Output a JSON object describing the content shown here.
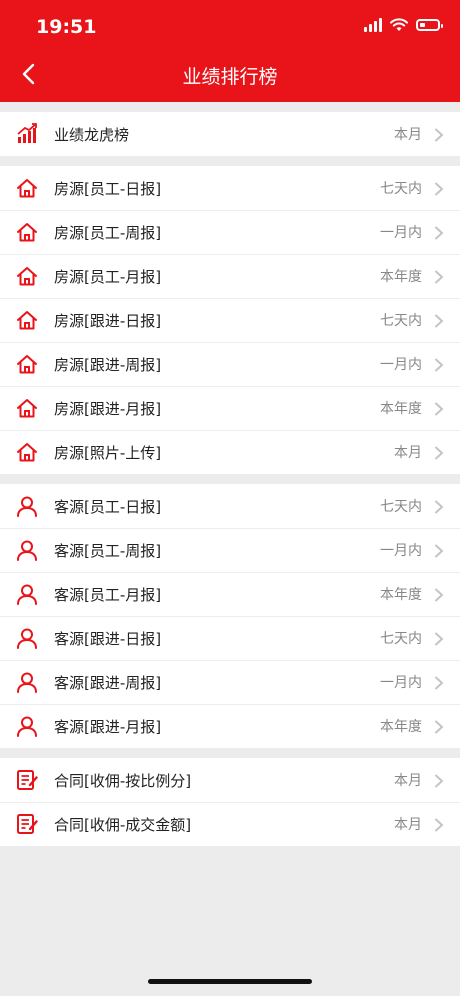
{
  "status": {
    "time": "19:51"
  },
  "header": {
    "title": "业绩排行榜"
  },
  "sections": [
    {
      "items": [
        {
          "label": "业绩龙虎榜",
          "meta": "本月",
          "icon": "chart"
        }
      ]
    },
    {
      "items": [
        {
          "label": "房源[员工-日报]",
          "meta": "七天内",
          "icon": "house"
        },
        {
          "label": "房源[员工-周报]",
          "meta": "一月内",
          "icon": "house"
        },
        {
          "label": "房源[员工-月报]",
          "meta": "本年度",
          "icon": "house"
        },
        {
          "label": "房源[跟进-日报]",
          "meta": "七天内",
          "icon": "house"
        },
        {
          "label": "房源[跟进-周报]",
          "meta": "一月内",
          "icon": "house"
        },
        {
          "label": "房源[跟进-月报]",
          "meta": "本年度",
          "icon": "house"
        },
        {
          "label": "房源[照片-上传]",
          "meta": "本月",
          "icon": "house"
        }
      ]
    },
    {
      "items": [
        {
          "label": "客源[员工-日报]",
          "meta": "七天内",
          "icon": "person"
        },
        {
          "label": "客源[员工-周报]",
          "meta": "一月内",
          "icon": "person"
        },
        {
          "label": "客源[员工-月报]",
          "meta": "本年度",
          "icon": "person"
        },
        {
          "label": "客源[跟进-日报]",
          "meta": "七天内",
          "icon": "person"
        },
        {
          "label": "客源[跟进-周报]",
          "meta": "一月内",
          "icon": "person"
        },
        {
          "label": "客源[跟进-月报]",
          "meta": "本年度",
          "icon": "person"
        }
      ]
    },
    {
      "items": [
        {
          "label": "合同[收佣-按比例分]",
          "meta": "本月",
          "icon": "contract"
        },
        {
          "label": "合同[收佣-成交金额]",
          "meta": "本月",
          "icon": "contract"
        }
      ]
    }
  ],
  "colors": {
    "accent": "#e8141a",
    "background": "#ececec"
  }
}
